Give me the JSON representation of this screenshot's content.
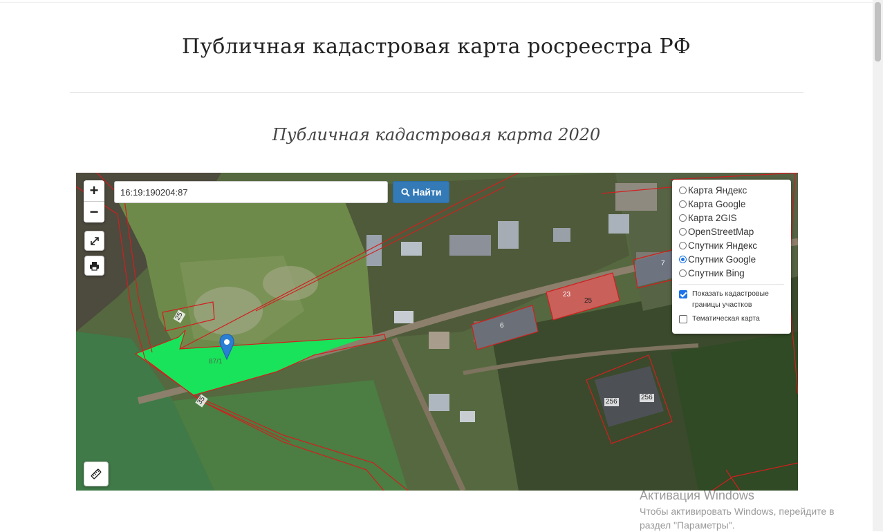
{
  "header": {
    "title": "Публичная кадастровая карта росреестра РФ",
    "subtitle": "Публичная кадастровая карта 2020"
  },
  "map": {
    "zoom_in_label": "+",
    "zoom_out_label": "−",
    "search": {
      "value": "16:19:190204:87",
      "button_label": "Найти"
    },
    "layers": {
      "options": [
        {
          "label": "Карта Яндекс",
          "selected": false
        },
        {
          "label": "Карта Google",
          "selected": false
        },
        {
          "label": "Карта 2GIS",
          "selected": false
        },
        {
          "label": "OpenStreetMap",
          "selected": false
        },
        {
          "label": "Спутник Яндекс",
          "selected": false
        },
        {
          "label": "Спутник Google",
          "selected": true
        },
        {
          "label": "Спутник Bing",
          "selected": false
        }
      ],
      "show_cadastral": {
        "label": "Показать кадастровые границы участков",
        "checked": true
      },
      "thematic": {
        "label": "Тематическая карта",
        "checked": false
      }
    },
    "parcel_labels": {
      "p25a": "25",
      "p87": "87/1",
      "p35": "35",
      "p6": "6",
      "p23": "23",
      "p25b": "25",
      "p7": "7",
      "p256a": "256",
      "p256b": "256"
    },
    "colors": {
      "selected_parcel": "#19e35a",
      "boundary": "#d11f1f",
      "marker": "#2a7ed4"
    }
  },
  "watermark": {
    "title": "Активация Windows",
    "line1": "Чтобы активировать Windows, перейдите в",
    "line2": "раздел \"Параметры\"."
  }
}
